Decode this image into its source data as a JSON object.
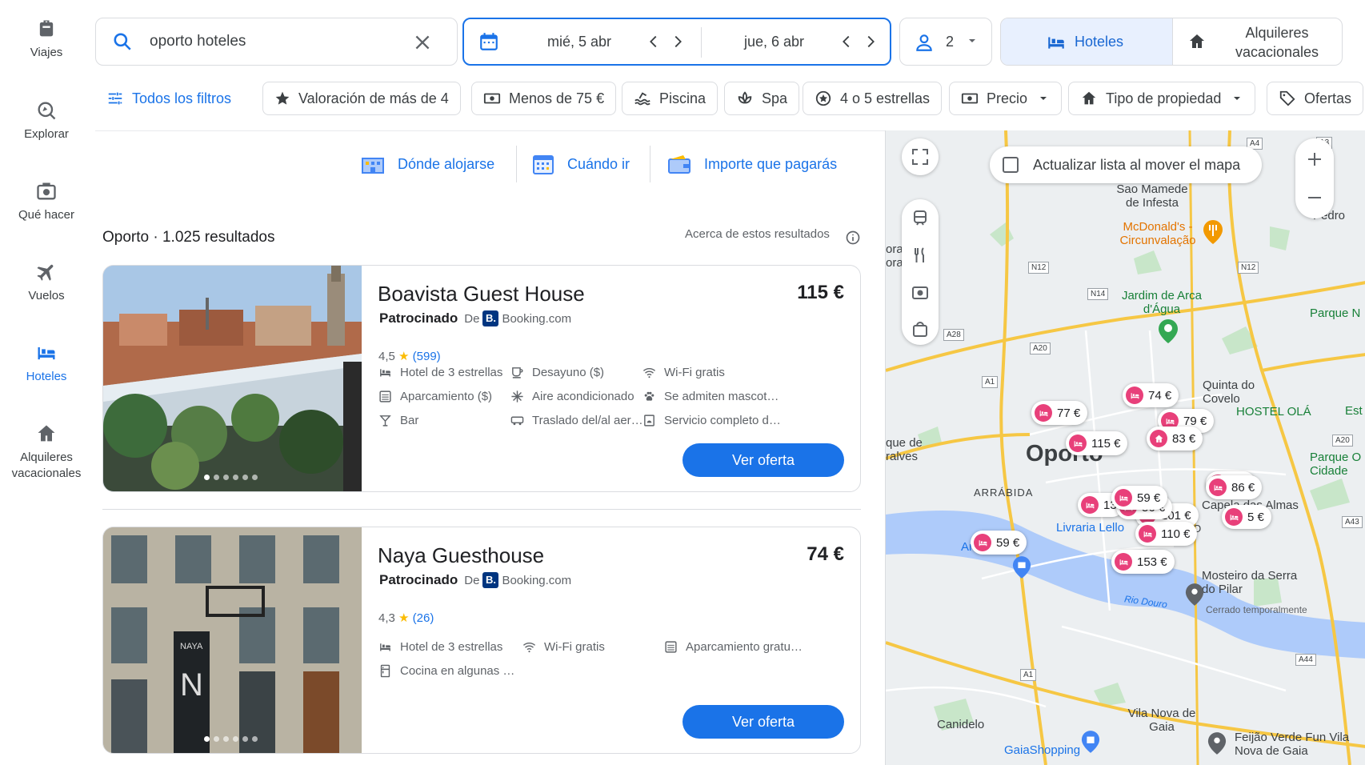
{
  "rail": {
    "items": [
      {
        "label": "Viajes",
        "icon": "travel-bag-icon"
      },
      {
        "label": "Explorar",
        "icon": "explore-icon"
      },
      {
        "label": "Qué hacer",
        "icon": "camera-icon"
      },
      {
        "label": "Vuelos",
        "icon": "plane-icon"
      },
      {
        "label": "Hoteles",
        "icon": "bed-icon"
      },
      {
        "label": "Alquileres vacacionales",
        "icon": "house-icon"
      }
    ]
  },
  "search": {
    "value": "oporto hoteles"
  },
  "dates": {
    "checkin": "mié, 5 abr",
    "checkout": "jue, 6 abr"
  },
  "guests": {
    "count": "2"
  },
  "type_toggle": {
    "hotels": "Hoteles",
    "rentals": "Alquileres vacacionales"
  },
  "filters": [
    "Todos los filtros",
    "Valoración de más de 4",
    "Menos de 75 €",
    "Piscina",
    "Spa",
    "4 o 5 estrellas",
    "Precio",
    "Tipo de propiedad",
    "Ofertas"
  ],
  "info_tabs": [
    "Dónde alojarse",
    "Cuándo ir",
    "Importe que pagarás"
  ],
  "results": {
    "title": "Oporto · 1.025 resultados",
    "about": "Acerca de estos resultados"
  },
  "hotels": [
    {
      "name": "Boavista Guest House",
      "price": "115 €",
      "sponsored": "Patrocinado",
      "from": "De",
      "provider": "Booking.com",
      "rating": "4,5",
      "reviews": "(599)",
      "amenities": [
        "Hotel de 3 estrellas",
        "Desayuno ($)",
        "Wi-Fi gratis",
        "Aparcamiento ($)",
        "Aire acondicionado",
        "Se admiten mascot…",
        "Bar",
        "Traslado del/al aer…",
        "Servicio completo d…"
      ],
      "cta": "Ver oferta"
    },
    {
      "name": "Naya Guesthouse",
      "price": "74 €",
      "sponsored": "Patrocinado",
      "from": "De",
      "provider": "Booking.com",
      "rating": "4,3",
      "reviews": "(26)",
      "amenities": [
        "Hotel de 3 estrellas",
        "Wi-Fi gratis",
        "Aparcamiento gratu…",
        "Cocina en algunas …"
      ],
      "cta": "Ver oferta"
    }
  ],
  "map": {
    "update_label": "Actualizar lista al mover el mapa",
    "labels": [
      "Sao Mamede de Infesta",
      "McDonald's - Circunvalação",
      "Jardim de Arca d'Água",
      "Pedro",
      "Parque N",
      "Oporto",
      "ARRÁBIDA",
      "Livraria Lello",
      "BOLHÃO",
      "Mosteiro da Serra do Pilar",
      "Cerrado temporalmente",
      "Rio Douro",
      "Canidelo",
      "Vila Nova de Gaia",
      "GaiaShopping",
      "Feijão Verde Fun Vila Nova de Gaia",
      "Parque O Cidade",
      "Quinta do Covelo",
      "Capela das Almas",
      "Arrábida",
      "que de ralves",
      "ora ora",
      "HOSTEL OLÁ",
      "Est"
    ],
    "road_tags": [
      "N12",
      "N14",
      "A20",
      "A1",
      "A4",
      "A3",
      "A20",
      "A43",
      "A44",
      "A28",
      "N12",
      "A1"
    ],
    "prices": [
      "74 €",
      "77 €",
      "79 €",
      "115 €",
      "83 €",
      "101 €",
      "13",
      "56 €",
      "86 €",
      "110 €",
      "59 €",
      "153 €",
      "1 €",
      "5 €"
    ]
  },
  "colors": {
    "accent": "#1a73e8",
    "pin": "#e8407a",
    "star": "#fbbc04"
  }
}
